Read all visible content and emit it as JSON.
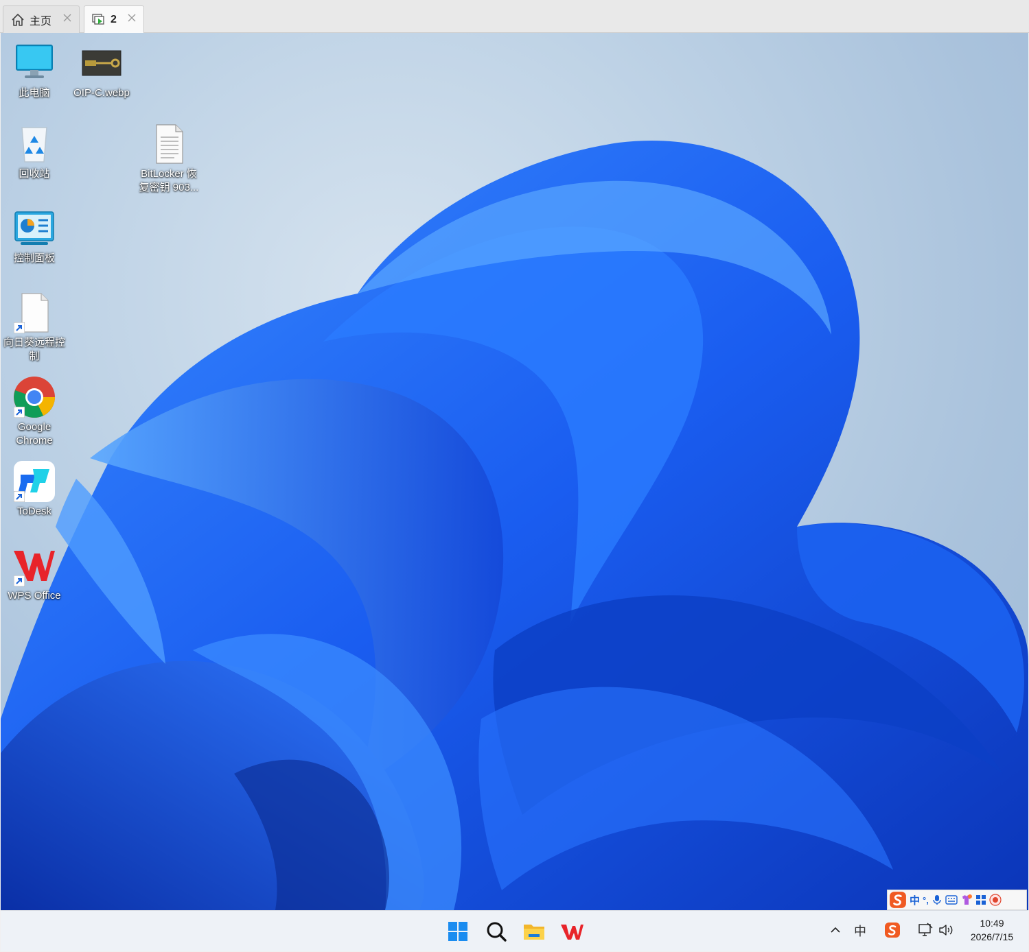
{
  "tabs": [
    {
      "label": "主页",
      "icon": "home-icon"
    },
    {
      "label": "2",
      "icon": "remote-session-icon"
    }
  ],
  "desktop_icons": [
    {
      "label": "此电脑",
      "icon": "monitor-icon"
    },
    {
      "label": "OIP-C.webp",
      "icon": "image-file-icon"
    },
    {
      "label": "回收站",
      "icon": "recycle-bin-icon"
    },
    {
      "label": "BitLocker 恢\n复密钥 903...",
      "line1": "BitLocker 恢",
      "line2": "复密钥 903...",
      "icon": "text-document-icon"
    },
    {
      "label": "控制面板",
      "icon": "control-panel-icon"
    },
    {
      "label": "向日葵远程控制",
      "line1": "向日葵远程控",
      "line2": "制",
      "icon": "blank-document-icon"
    },
    {
      "label": "Google Chrome",
      "line1": "Google",
      "line2": "Chrome",
      "icon": "chrome-icon"
    },
    {
      "label": "ToDesk",
      "icon": "todesk-icon"
    },
    {
      "label": "WPS Office",
      "icon": "wps-icon"
    }
  ],
  "ime_bar": {
    "lang": "中",
    "punct": "°,",
    "items": [
      "sogou-icon",
      "mic-icon",
      "keyboard-icon",
      "skin-icon",
      "toolbox-icon",
      "avatar-icon"
    ]
  },
  "taskbar": {
    "pinned": [
      "windows-start-icon",
      "search-icon",
      "file-explorer-icon",
      "wps-icon"
    ],
    "tray": {
      "ime_indicator": "中",
      "time": "10:49",
      "date": "2026/7/15"
    }
  },
  "colors": {
    "wallpaper_blue": "#1a5df0",
    "wallpaper_light": "#c5d7ea",
    "taskbar_bg": "#eef2f7",
    "wps_red": "#e8242a"
  }
}
